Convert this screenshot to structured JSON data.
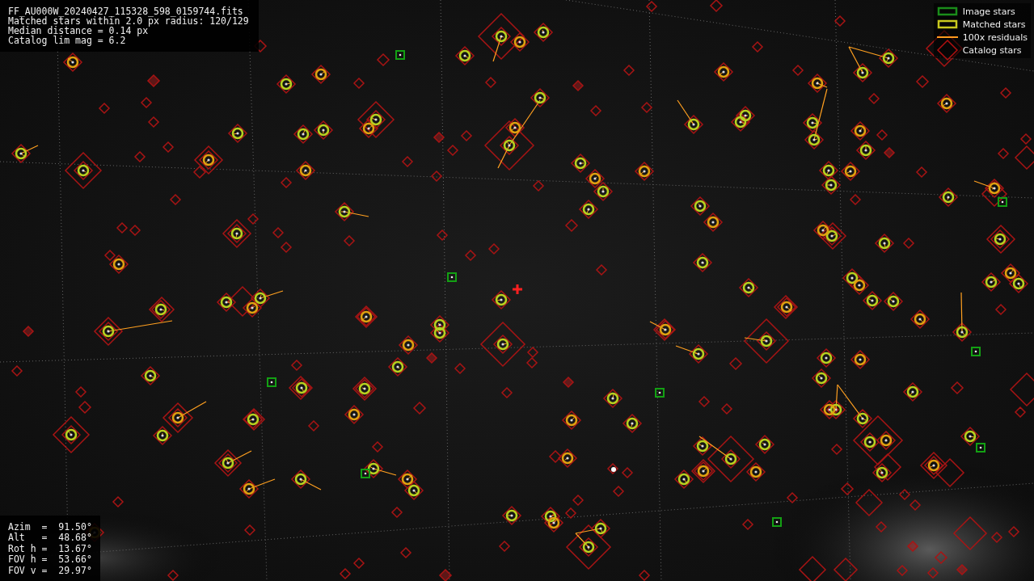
{
  "info_lines": [
    "FF_AU000W_20240427_115328_598_0159744.fits",
    "Matched stars within 2.0 px radius: 120/129",
    "Median distance = 0.14 px",
    "Catalog lim mag = 6.2"
  ],
  "legend": [
    {
      "kind": "image_stars",
      "label": "Image stars",
      "color": "#1a8c1a"
    },
    {
      "kind": "matched_stars",
      "label": "Matched stars",
      "color": "#c8c81e"
    },
    {
      "kind": "residuals",
      "label": "100x residuals",
      "color": "#ff9a1e"
    },
    {
      "kind": "catalog_stars",
      "label": "Catalog stars",
      "color": "#b01010"
    }
  ],
  "pointing": [
    "Azim  =  91.50°",
    "Alt   =  48.68°",
    "Rot h =  13.67°",
    "FOV h =  53.66°",
    "FOV v =  29.97°"
  ]
}
